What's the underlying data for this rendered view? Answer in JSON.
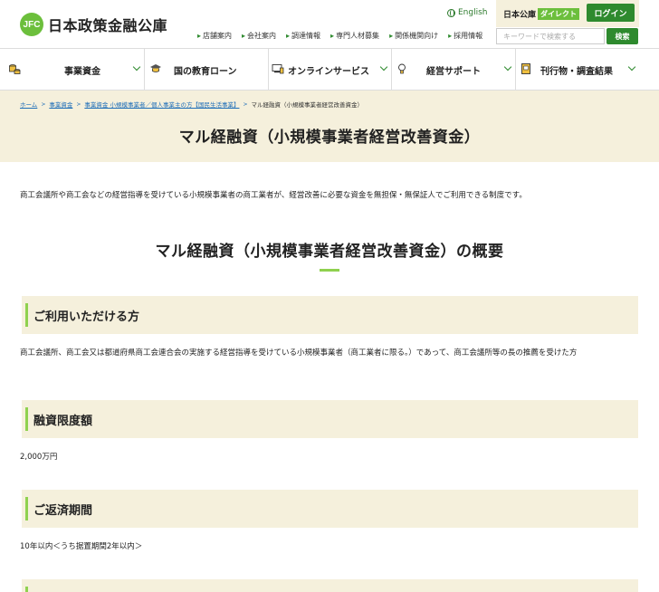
{
  "header": {
    "logo_mark": "JFC",
    "logo_text": "日本政策金融公庫",
    "english": "English",
    "direct_label": "日本公庫",
    "direct_badge": "ダイレクト",
    "login": "ログイン",
    "links": [
      "店舗案内",
      "会社案内",
      "調達情報",
      "専門人材募集",
      "関係機関向け",
      "採用情報"
    ],
    "search_placeholder": "キーワードで検索する",
    "search_button": "検索"
  },
  "nav": {
    "items": [
      {
        "label": "事業資金",
        "icon": "coins-icon"
      },
      {
        "label": "国の教育ローン",
        "icon": "graduation-cap-icon"
      },
      {
        "label": "オンラインサービス",
        "icon": "computer-icon"
      },
      {
        "label": "経営サポート",
        "icon": "lightbulb-icon"
      },
      {
        "label": "刊行物・調査結果",
        "icon": "book-icon"
      }
    ]
  },
  "breadcrumb": {
    "items": [
      "ホーム",
      "事業資金",
      "事業資金 小規模事業者／個人事業主の方【国民生活事業】",
      "マル経融資（小規模事業者経営改善資金）"
    ]
  },
  "page": {
    "title": "マル経融資（小規模事業者経営改善資金）",
    "intro": "商工会議所や商工会などの経営指導を受けている小規模事業者の商工業者が、経営改善に必要な資金を無担保・無保証人でご利用できる制度です。",
    "section_title": "マル経融資（小規模事業者経営改善資金）の概要"
  },
  "blocks": [
    {
      "heading": "ご利用いただける方",
      "text": "商工会議所、商工会又は都道府県商工会連合会の実施する経営指導を受けている小規模事業者（商工業者に限る。）であって、商工会議所等の長の推薦を受けた方"
    },
    {
      "heading": "融資限度額",
      "text": "2,000万円"
    },
    {
      "heading": "ご返済期間",
      "text": "10年以内＜うち据置期間2年以内＞"
    }
  ]
}
